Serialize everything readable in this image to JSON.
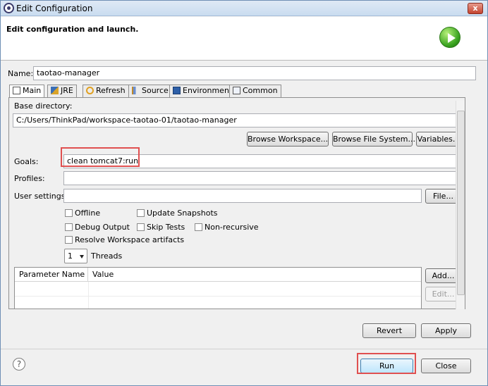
{
  "window": {
    "title": "Edit Configuration",
    "close_glyph": "x"
  },
  "banner": {
    "title": "Edit configuration and launch."
  },
  "name_field": {
    "label": "Name:",
    "value": "taotao-manager"
  },
  "tabs": [
    {
      "label": "Main",
      "icon": "main-tab-icon"
    },
    {
      "label": "JRE",
      "icon": "jre-icon"
    },
    {
      "label": "Refresh",
      "icon": "refresh-icon"
    },
    {
      "label": "Source",
      "icon": "source-icon"
    },
    {
      "label": "Environment",
      "icon": "environment-icon"
    },
    {
      "label": "Common",
      "icon": "common-icon"
    }
  ],
  "main": {
    "base_dir_label": "Base directory:",
    "base_dir_value": "C:/Users/ThinkPad/workspace-taotao-01/taotao-manager",
    "browse_workspace": "Browse Workspace...",
    "browse_file_system": "Browse File System...",
    "variables": "Variables...",
    "goals_label": "Goals:",
    "goals_value": "clean tomcat7:run",
    "profiles_label": "Profiles:",
    "profiles_value": "",
    "user_settings_label": "User settings:",
    "user_settings_value": "",
    "file_button": "File...",
    "options": {
      "offline": "Offline",
      "update_snapshots": "Update Snapshots",
      "debug_output": "Debug Output",
      "skip_tests": "Skip Tests",
      "non_recursive": "Non-recursive",
      "resolve_workspace": "Resolve Workspace artifacts"
    },
    "threads_value": "1",
    "threads_label": "Threads",
    "param_table": {
      "columns": [
        "Parameter Name",
        "Value"
      ]
    },
    "add_button": "Add...",
    "edit_button": "Edit..."
  },
  "footer": {
    "revert": "Revert",
    "apply": "Apply",
    "help_glyph": "?",
    "run": "Run",
    "close": "Close"
  },
  "colors": {
    "highlight": "#e05050",
    "title_bar": "#c9dcf0",
    "accent_green": "#38a21f"
  }
}
